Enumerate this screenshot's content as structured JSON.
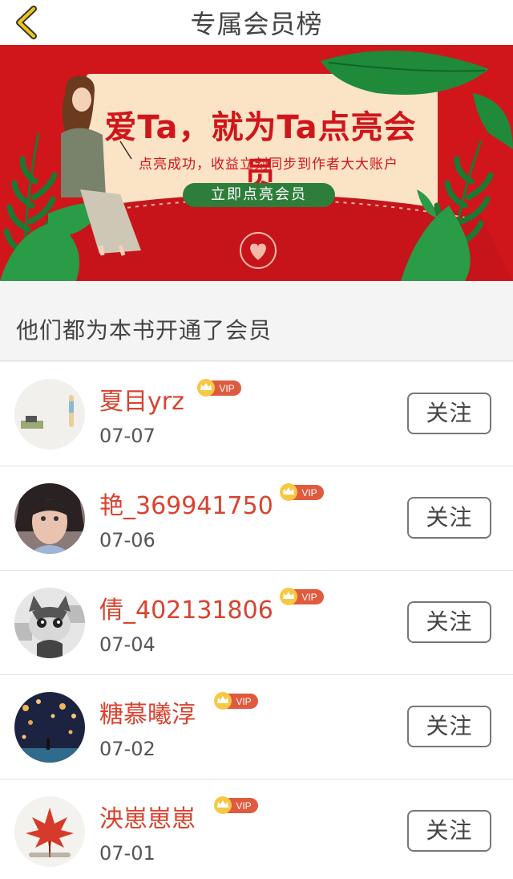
{
  "header": {
    "title": "专属会员榜",
    "back_icon": "chevron-left-icon",
    "accent": "#e6b422"
  },
  "banner": {
    "headline": "爱Ta，就为Ta点亮会员",
    "subtitle": "点亮成功，收益立刻同步到作者大大账户",
    "cta": "立即点亮会员",
    "colors": {
      "background": "#d0161b",
      "card": "#fbe3c6",
      "button": "#2e7d3a"
    }
  },
  "section": {
    "heading": "他们都为本书开通了会员"
  },
  "badge": {
    "text": "VIP",
    "icon": "crown-icon"
  },
  "follow_label": "关注",
  "members": [
    {
      "name": "夏目yrz",
      "date": "07-07"
    },
    {
      "name": "艳_369941750",
      "date": "07-06"
    },
    {
      "name": "倩_402131806",
      "date": "07-04"
    },
    {
      "name": "糖慕曦淳",
      "date": "07-02"
    },
    {
      "name": "泱崽崽崽",
      "date": "07-01"
    }
  ]
}
